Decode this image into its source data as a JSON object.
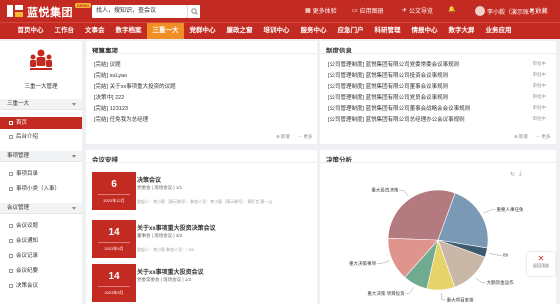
{
  "header": {
    "brand": "蓝悦集团",
    "badge": "DEMO",
    "search_placeholder": "找人，搜知识，查会议",
    "links": [
      "更多体验",
      "应用图册",
      "公文导览"
    ],
    "user": "李小毅（演示账号）",
    "collapse": "收藏"
  },
  "nav": [
    "首页中心",
    "工作台",
    "文事会",
    "数字档案",
    "三重一大",
    "党群中心",
    "廉政之窗",
    "培训中心",
    "服务中心",
    "应急门户",
    "科研管理",
    "情报中心",
    "数字大屏",
    "业务应用"
  ],
  "nav_active_index": 4,
  "sidebar": {
    "user_name": "三重一大管理",
    "groups": [
      {
        "label": "三重一大",
        "items": [
          "首页",
          "后台介绍"
        ]
      },
      {
        "label": "事项管理",
        "items": [
          "事项目录",
          "事项小类（入事）"
        ]
      },
      {
        "label": "会议管理",
        "items": [
          "会议议题",
          "会议通知",
          "会议记录",
          "会议纪要",
          "决策会议"
        ]
      }
    ]
  },
  "pending": {
    "title": "预算事项",
    "items": [
      "[完结] 议题",
      "[完结] xuLyao",
      "[完结] 关于xx事项重大投资的议题",
      "[决策中] 222",
      "[完结] 123123",
      "[完结] 任免我为总经理"
    ],
    "footer_new": "新增",
    "footer_more": "更多"
  },
  "rules": {
    "title": "制度信息",
    "items": [
      {
        "text": "[公司管理制度] 蓝悦集团有限公司党委常委会议事规则",
        "tag": "审批中"
      },
      {
        "text": "[公司管理制度] 蓝悦集团有限公司投资会议事规则",
        "tag": "审批中"
      },
      {
        "text": "[公司管理制度] 蓝悦集团有限公司董事会议事规则",
        "tag": "审批中"
      },
      {
        "text": "[公司管理制度] 蓝悦集团有限公司党员会议事规则",
        "tag": "审批中"
      },
      {
        "text": "[公司管理制度] 蓝悦集团有限公司董事会战略会会议事规则",
        "tag": "审批中"
      },
      {
        "text": "[公司管理制度] 蓝悦集团有限公司总经理办公会议事规则",
        "tag": "审批中"
      }
    ],
    "footer_new": "新增",
    "footer_more": "更多"
  },
  "meetings": {
    "title": "会议安排",
    "items": [
      {
        "day": "6",
        "month": "2023年12月",
        "title": "决策会议",
        "sub": "党委会 | 现场会议 | 1/1",
        "people": "发起人：李小毅（演示账号）  参加人员：李小毅（演示账号）  郑旺言  蔡一山"
      },
      {
        "day": "14",
        "month": "2023年9月",
        "title": "关于xx事项重大投资决策会议",
        "sub": "董事会 | 现场会议 | 3/3",
        "people": "发起人：李小毅  参加人员：/ 3/3"
      },
      {
        "day": "14",
        "month": "2023年9月",
        "title": "关于xx事项重大投资会议",
        "sub": "党委常委会 | 现场会议 | 1/3",
        "people": ""
      }
    ]
  },
  "analysis": {
    "title": "决策分析"
  },
  "chart_data": {
    "type": "pie",
    "title": "",
    "categories": [
      "重要人事任免",
      "89",
      "大额资金运作",
      "重大项目安排",
      "重大决策 项目投资",
      "重大决策事项",
      "重大投资决策"
    ],
    "values": [
      22,
      3,
      14,
      9,
      8,
      14,
      30
    ],
    "colors": [
      "#7a99b5",
      "#3a5c6e",
      "#c9b8a8",
      "#e6d36a",
      "#71ab8f",
      "#e0948e",
      "#b37a7f"
    ]
  },
  "fab": {
    "label": "返回顶部",
    "icon": "close-icon"
  }
}
